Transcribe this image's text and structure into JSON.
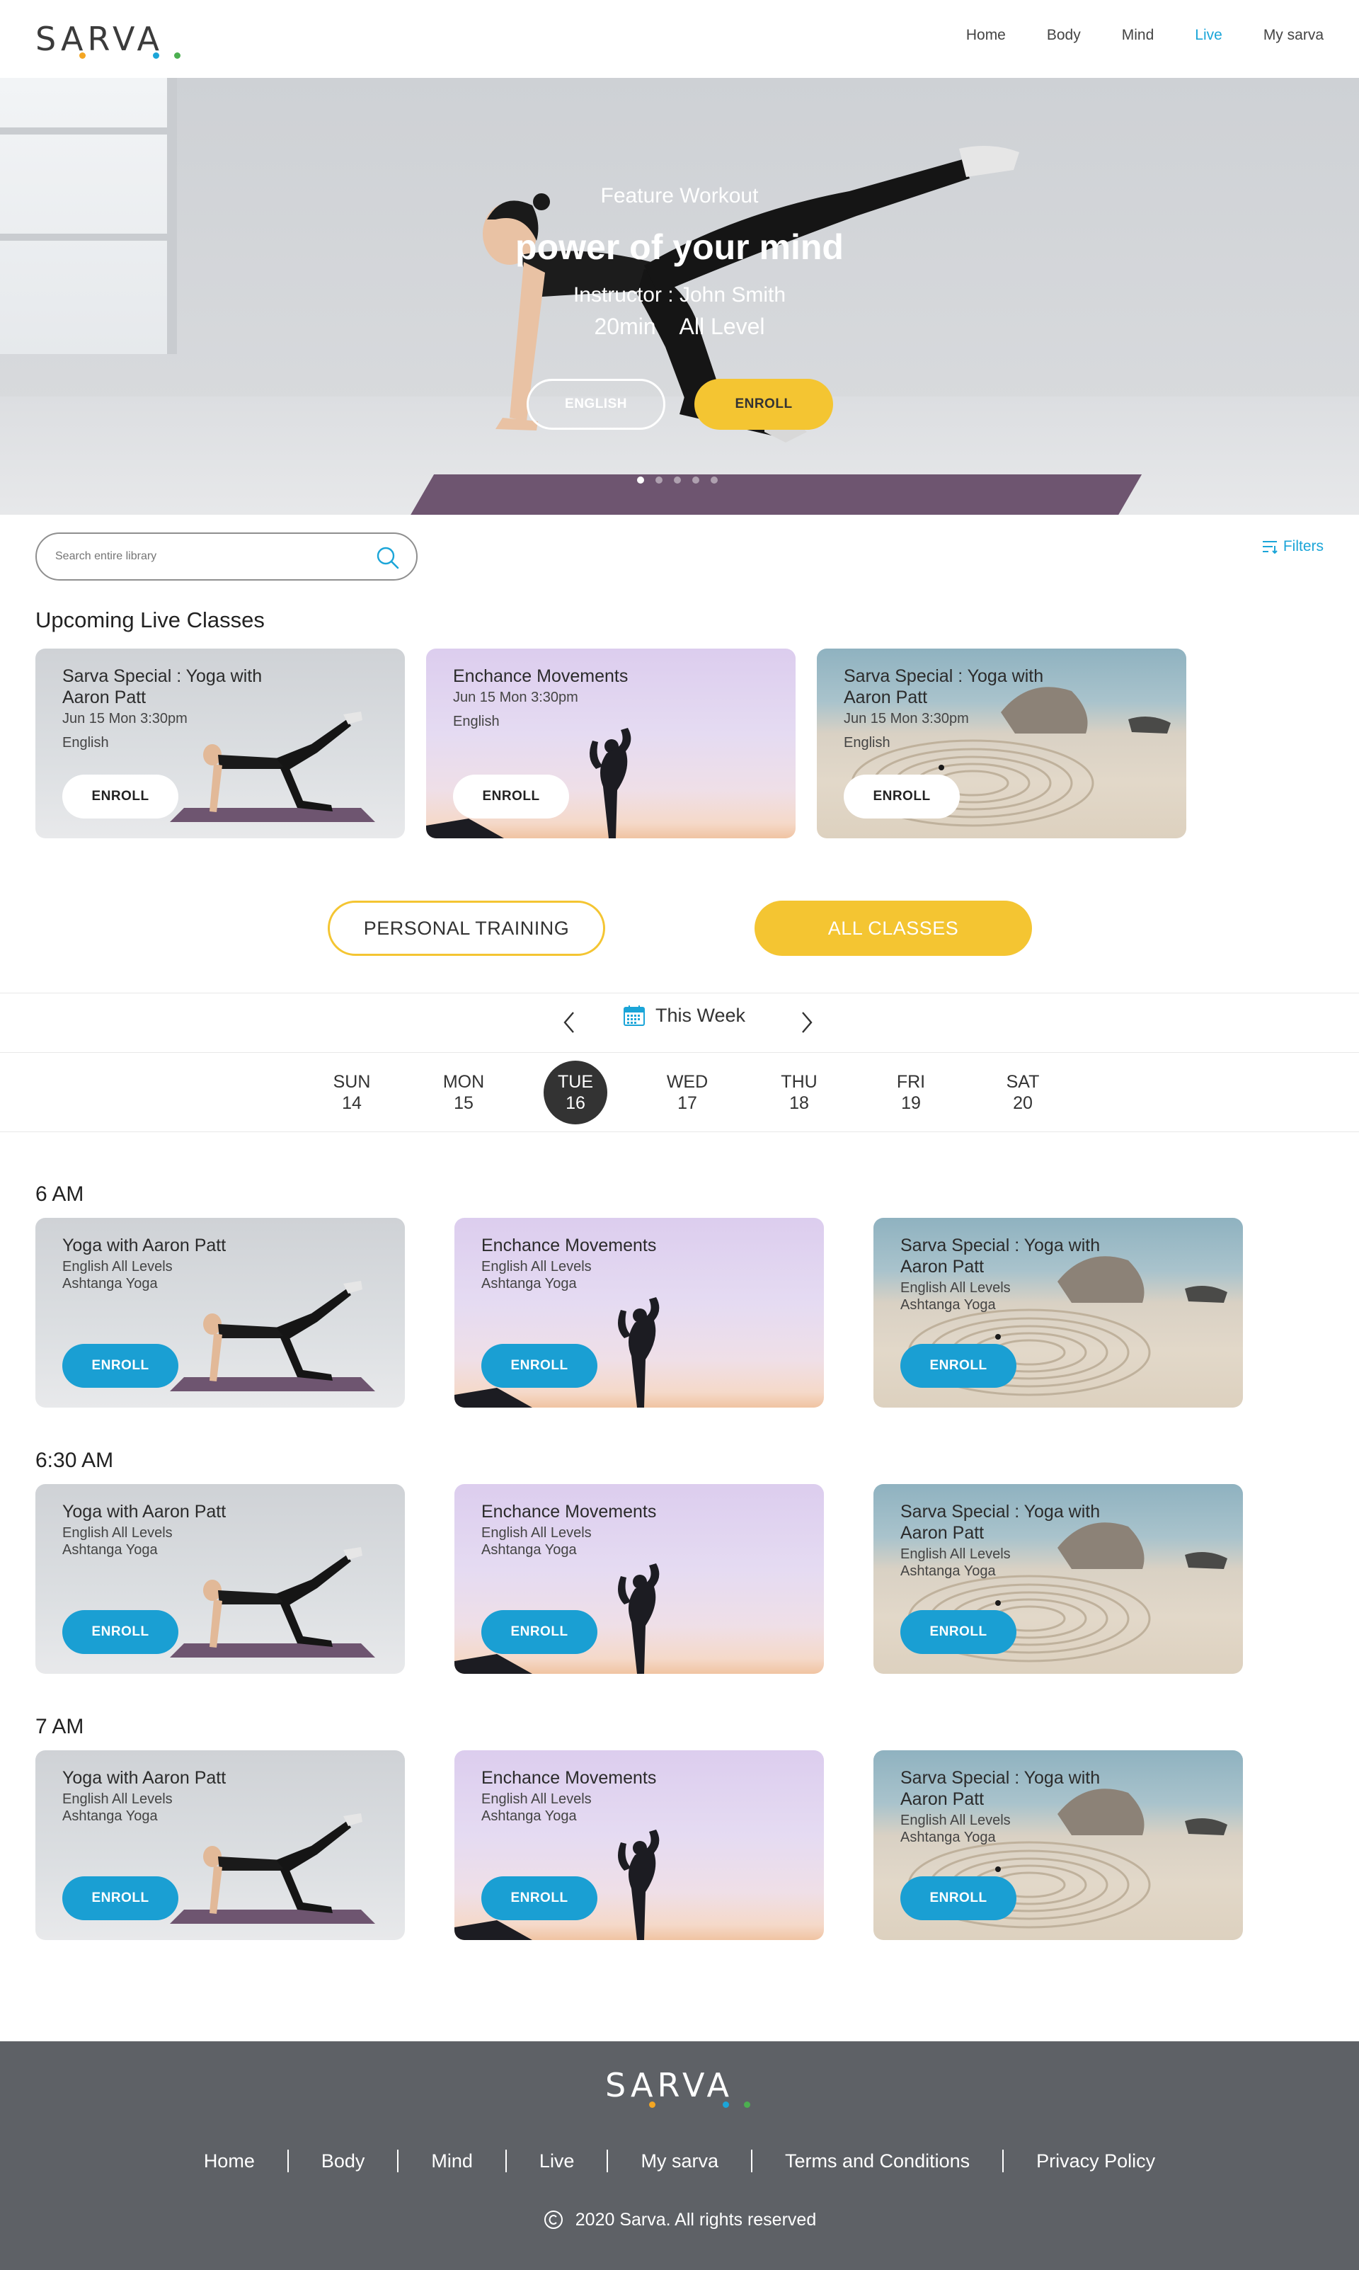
{
  "brand": {
    "name": "SARVA",
    "accent_blue": "#1ba5d8",
    "accent_yellow": "#f4c532",
    "dot_colors": [
      "#f4a623",
      "#1ba5d8",
      "#4caf50"
    ]
  },
  "nav": {
    "items": [
      {
        "label": "Home",
        "active": false
      },
      {
        "label": "Body",
        "active": false
      },
      {
        "label": "Mind",
        "active": false
      },
      {
        "label": "Live",
        "active": true
      },
      {
        "label": "My sarva",
        "active": false
      }
    ]
  },
  "hero": {
    "eyebrow": "Feature Workout",
    "title": "power of your mind",
    "instructor": "Instructor : John Smith",
    "duration": "20min",
    "level": "All Level",
    "language_button": "ENGLISH",
    "enroll_button": "ENROLL",
    "slides": 5,
    "active_slide": 1
  },
  "search": {
    "placeholder": "Search entire library",
    "filters_label": "Filters"
  },
  "upcoming": {
    "title": "Upcoming Live Classes",
    "cards": [
      {
        "title": "Sarva Special : Yoga with Aaron Patt",
        "line1": "Jun 15 Mon 3:30pm",
        "line2": "English",
        "button": "ENROLL",
        "image": "yoga-pose"
      },
      {
        "title": "Enchance Movements",
        "line1": "Jun 15 Mon 3:30pm",
        "line2": "English",
        "button": "ENROLL",
        "image": "sunset-silhouette"
      },
      {
        "title": "Sarva Special : Yoga with Aaron Patt",
        "line1": "Jun 15 Mon 3:30pm",
        "line2": "English",
        "button": "ENROLL",
        "image": "beach-labyrinth"
      }
    ]
  },
  "toggles": {
    "personal_training": "PERSONAL TRAINING",
    "all_classes": "ALL CLASSES"
  },
  "week": {
    "label": "This Week",
    "days": [
      {
        "name": "SUN",
        "date": "14",
        "active": false
      },
      {
        "name": "MON",
        "date": "15",
        "active": false
      },
      {
        "name": "TUE",
        "date": "16",
        "active": true
      },
      {
        "name": "WED",
        "date": "17",
        "active": false
      },
      {
        "name": "THU",
        "date": "18",
        "active": false
      },
      {
        "name": "FRI",
        "date": "19",
        "active": false
      },
      {
        "name": "SAT",
        "date": "20",
        "active": false
      }
    ]
  },
  "schedule": [
    {
      "time": "6 AM",
      "classes": [
        {
          "title": "Yoga with Aaron Patt",
          "line1": "English All Levels",
          "line2": "Ashtanga Yoga",
          "button": "ENROLL",
          "image": "yoga-pose"
        },
        {
          "title": "Enchance Movements",
          "line1": "English All Levels",
          "line2": "Ashtanga Yoga",
          "button": "ENROLL",
          "image": "sunset-silhouette"
        },
        {
          "title": "Sarva Special : Yoga with Aaron Patt",
          "line1": "English All Levels",
          "line2": "Ashtanga Yoga",
          "button": "ENROLL",
          "image": "beach-labyrinth"
        }
      ]
    },
    {
      "time": "6:30 AM",
      "classes": [
        {
          "title": "Yoga with Aaron Patt",
          "line1": "English All Levels",
          "line2": "Ashtanga Yoga",
          "button": "ENROLL",
          "image": "yoga-pose"
        },
        {
          "title": "Enchance Movements",
          "line1": "English All Levels",
          "line2": "Ashtanga Yoga",
          "button": "ENROLL",
          "image": "sunset-silhouette"
        },
        {
          "title": "Sarva Special : Yoga with Aaron Patt",
          "line1": "English All Levels",
          "line2": "Ashtanga Yoga",
          "button": "ENROLL",
          "image": "beach-labyrinth"
        }
      ]
    },
    {
      "time": "7 AM",
      "classes": [
        {
          "title": "Yoga with Aaron Patt",
          "line1": "English All Levels",
          "line2": "Ashtanga Yoga",
          "button": "ENROLL",
          "image": "yoga-pose"
        },
        {
          "title": "Enchance Movements",
          "line1": "English All Levels",
          "line2": "Ashtanga Yoga",
          "button": "ENROLL",
          "image": "sunset-silhouette"
        },
        {
          "title": "Sarva Special : Yoga with Aaron Patt",
          "line1": "English All Levels",
          "line2": "Ashtanga Yoga",
          "button": "ENROLL",
          "image": "beach-labyrinth"
        }
      ]
    }
  ],
  "footer": {
    "links": [
      "Home",
      "Body",
      "Mind",
      "Live",
      "My sarva",
      "Terms and Conditions",
      "Privacy Policy"
    ],
    "copyright_symbol": "c",
    "copyright": "2020 Sarva. All rights reserved"
  }
}
